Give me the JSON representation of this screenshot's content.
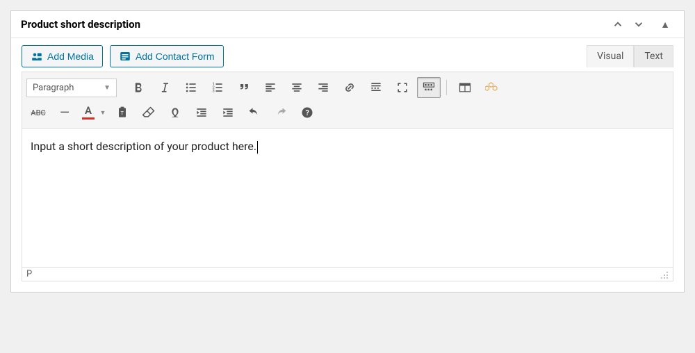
{
  "panel": {
    "title": "Product short description"
  },
  "buttons": {
    "add_media": "Add Media",
    "add_contact_form": "Add Contact Form"
  },
  "tabs": {
    "visual": "Visual",
    "text": "Text"
  },
  "toolbar": {
    "format_select": "Paragraph",
    "abc_label": "ABC",
    "text_color_letter": "A"
  },
  "editor": {
    "content": "Input a short description of your product here."
  },
  "status": {
    "path": "P"
  }
}
